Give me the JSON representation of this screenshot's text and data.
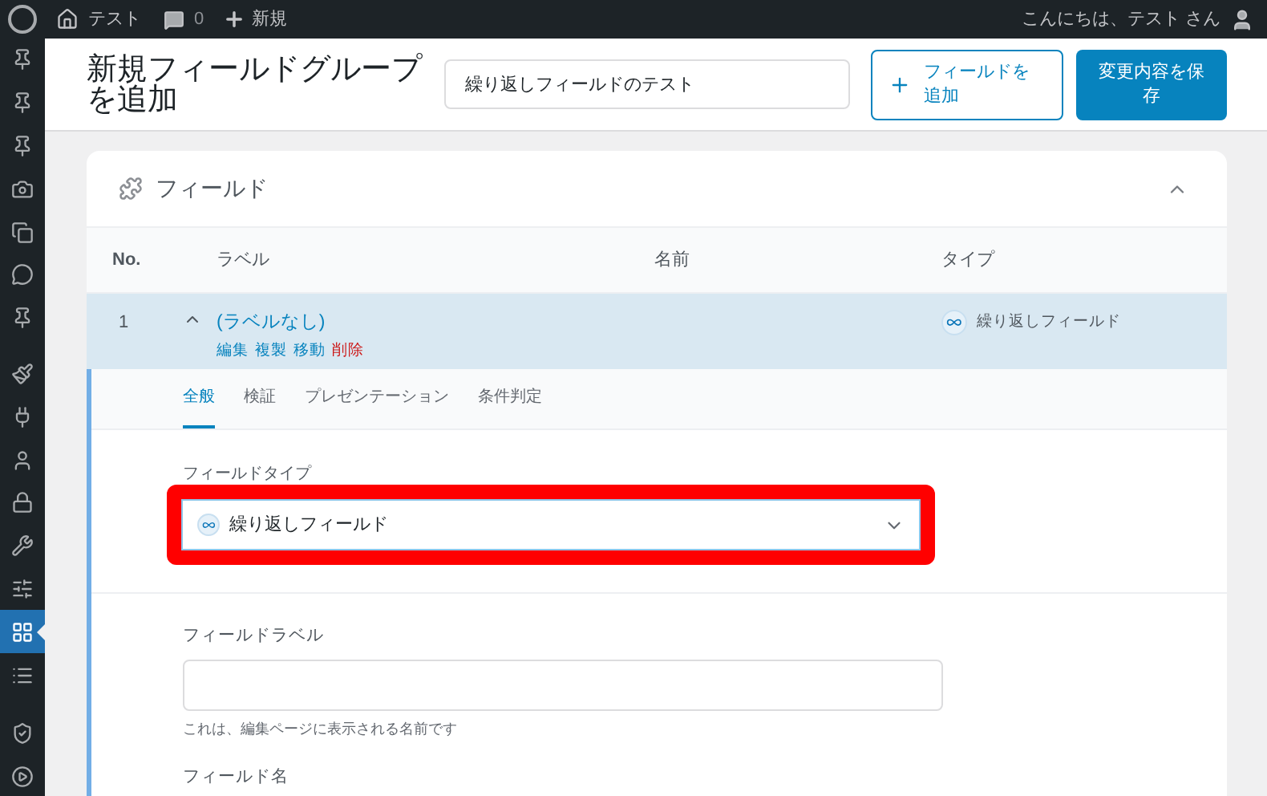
{
  "admin_bar": {
    "site": "テスト",
    "comments": "0",
    "new": "新規",
    "greeting": "こんにちは、テスト さん"
  },
  "sidebar": {
    "items": [
      {
        "selected": false
      },
      {
        "selected": false
      },
      {
        "selected": false
      },
      {
        "selected": false
      },
      {
        "selected": false
      },
      {
        "selected": false
      },
      {
        "selected": false
      },
      {
        "selected": false
      },
      {
        "selected": false
      },
      {
        "selected": false
      },
      {
        "selected": false
      },
      {
        "selected": false
      },
      {
        "selected": false
      },
      {
        "selected": true
      },
      {
        "selected": false
      },
      {
        "selected": false
      },
      {
        "selected": false
      }
    ]
  },
  "header": {
    "title": "新規フィールドグループを追加",
    "title_value": "繰り返しフィールドのテスト",
    "add_button": "フィールドを追加",
    "save_button": "変更内容を保存"
  },
  "card": {
    "title": "フィールド",
    "expanded": true
  },
  "table": {
    "columns": [
      "No.",
      "ラベル",
      "名前",
      "タイプ"
    ],
    "rows": [
      {
        "no": "1",
        "label": "(ラベルなし)",
        "actions": [
          {
            "text": "編集",
            "kind": "normal"
          },
          {
            "text": "複製",
            "kind": "normal"
          },
          {
            "text": "移動",
            "kind": "normal"
          },
          {
            "text": "削除",
            "kind": "danger"
          }
        ],
        "type": "繰り返しフィールド",
        "expanded": true
      }
    ]
  },
  "tabs": [
    {
      "label": "全般",
      "selected": true
    },
    {
      "label": "検証",
      "selected": false
    },
    {
      "label": "プレゼンテーション",
      "selected": false
    },
    {
      "label": "条件判定",
      "selected": false
    }
  ],
  "field_type": {
    "label": "フィールドタイプ",
    "value": "繰り返しフィールド",
    "highlighted": true
  },
  "field_label": {
    "label": "フィールドラベル",
    "help": "これは、編集ページに表示される名前です"
  },
  "field_name": {
    "label": "フィールド名"
  }
}
